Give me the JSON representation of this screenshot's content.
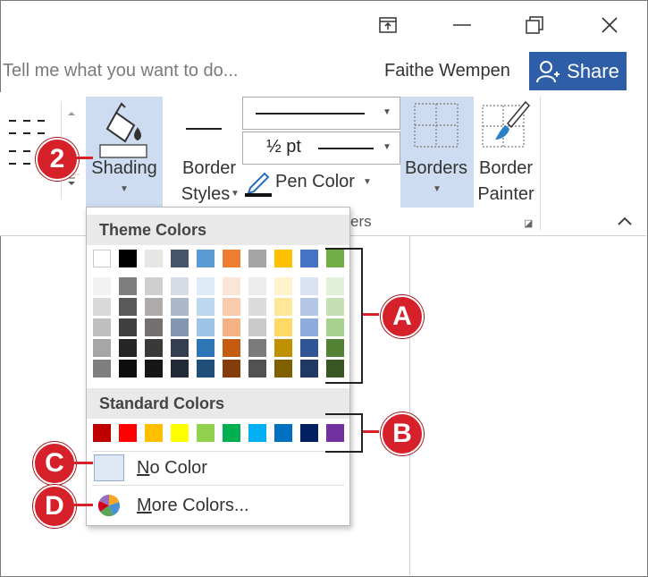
{
  "window": {
    "controls": [
      "ribbon-display-options",
      "minimize",
      "restore",
      "close"
    ]
  },
  "search": {
    "placeholder": "Tell me what you want to do..."
  },
  "account": {
    "user_name": "Faithe Wempen",
    "share_label": "Share"
  },
  "ribbon": {
    "shading_label": "Shading",
    "border_styles_line1": "Border",
    "border_styles_line2": "Styles",
    "pen_weight": "½ pt",
    "pen_color_label": "Pen Color",
    "borders_label": "Borders",
    "border_painter_line1": "Border",
    "border_painter_line2": "Painter",
    "group_label_partial": "ers"
  },
  "panel": {
    "theme_header": "Theme Colors",
    "standard_header": "Standard Colors",
    "no_color": "No Color",
    "more_colors": "More Colors...",
    "theme_top": [
      "#ffffff",
      "#000000",
      "#e7e6e6",
      "#44546a",
      "#5b9bd5",
      "#ed7d31",
      "#a5a5a5",
      "#ffc000",
      "#4472c4",
      "#70ad47"
    ],
    "theme_shades": [
      [
        "#f2f2f2",
        "#d9d9d9",
        "#bfbfbf",
        "#a6a6a6",
        "#7f7f7f"
      ],
      [
        "#7f7f7f",
        "#595959",
        "#404040",
        "#262626",
        "#0d0d0d"
      ],
      [
        "#d0cece",
        "#aeaaaa",
        "#757070",
        "#3a3838",
        "#171616"
      ],
      [
        "#d6dce5",
        "#adb9ca",
        "#8497b0",
        "#333f50",
        "#222a35"
      ],
      [
        "#deebf7",
        "#bdd7ee",
        "#9dc3e6",
        "#2e75b6",
        "#1f4e79"
      ],
      [
        "#fbe5d6",
        "#f8cbad",
        "#f4b183",
        "#c55a11",
        "#843c0c"
      ],
      [
        "#ededed",
        "#dbdbdb",
        "#c9c9c9",
        "#7b7b7b",
        "#525252"
      ],
      [
        "#fff2cc",
        "#ffe699",
        "#ffd966",
        "#bf9000",
        "#7f6000"
      ],
      [
        "#dae3f3",
        "#b4c7e7",
        "#8faadc",
        "#2f5597",
        "#203864"
      ],
      [
        "#e2f0d9",
        "#c5e0b4",
        "#a9d18e",
        "#548235",
        "#385723"
      ]
    ],
    "standard": [
      "#c00000",
      "#ff0000",
      "#ffc000",
      "#ffff00",
      "#92d050",
      "#00b050",
      "#00b0f0",
      "#0070c0",
      "#002060",
      "#7030a0"
    ]
  },
  "callouts": {
    "step": "2",
    "a": "A",
    "b": "B",
    "c": "C",
    "d": "D"
  }
}
